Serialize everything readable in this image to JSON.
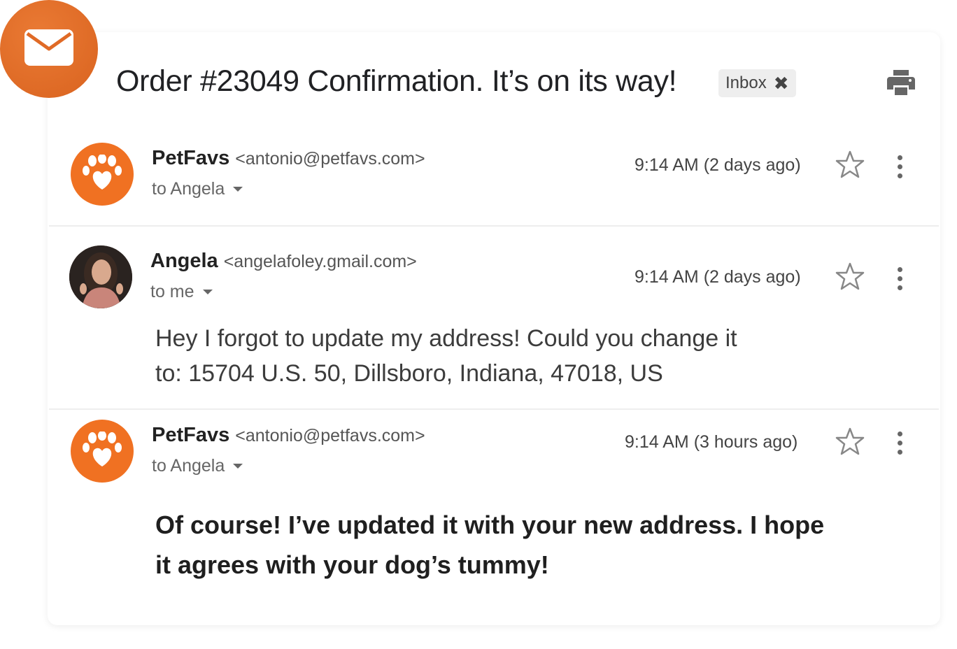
{
  "thread": {
    "subject": "Order #23049 Confirmation. It’s on its way!",
    "label_chip": "Inbox",
    "label_chip_close": "✖",
    "icons": {
      "app": "mail-icon",
      "print": "print-icon"
    }
  },
  "messages": [
    {
      "sender_name": "PetFavs",
      "sender_email": "<antonio@petfavs.com>",
      "recipient": "to Angela",
      "time": "9:14 AM",
      "relative_time": "(2 days ago)",
      "avatar": "paw-icon",
      "avatar_color": "#f07122"
    },
    {
      "sender_name": "Angela",
      "sender_email": "<angelafoley.gmail.com>",
      "recipient": "to me",
      "time": "9:14 AM",
      "relative_time": "(2 days ago)",
      "avatar": "user-photo",
      "body_line1": "Hey I forgot to update my address! Could you change it",
      "body_line2": "to: 15704 U.S. 50, Dillsboro, Indiana, 47018, US"
    },
    {
      "sender_name": "PetFavs",
      "sender_email": "<antonio@petfavs.com>",
      "recipient": "to Angela",
      "time": "9:14 AM",
      "relative_time": "(3 hours ago)",
      "avatar": "paw-icon",
      "avatar_color": "#f07122",
      "body_line1": "Of course! I’ve updated it with your new address. I hope",
      "body_line2": "it agrees with your dog’s tummy!"
    }
  ],
  "colors": {
    "accent": "#f07122",
    "badge": "#e06a26",
    "divider": "#eeeeee"
  }
}
